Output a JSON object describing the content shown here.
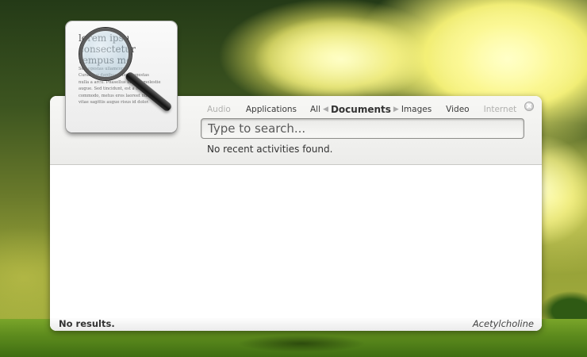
{
  "categories": {
    "audio": "Audio",
    "applications": "Applications",
    "all": "All",
    "documents": "Documents",
    "images": "Images",
    "video": "Video",
    "internet": "Internet"
  },
  "search": {
    "placeholder": "Type to search..."
  },
  "status": "No recent activities found.",
  "footer": {
    "results": "No results.",
    "theme": "Acetylcholine"
  },
  "icon": {
    "name": "documents-search-icon",
    "line1": "lorem ipsu",
    "line2": "consectetur",
    "line3": "tempus mo",
    "small_lines": [
      "amet,",
      "Nullam",
      "nisi.",
      "feugiat nisi.",
      "Sed egestas ullamcorp",
      "Curabitur dapibus. Morbi egestas",
      "nulla a arcu. Phasellus blandit molestie",
      "augue. Sed tincidunt, est a luctus",
      "commodo, metus eros laoreet nunc,",
      "vitae sagittis augue risus id dolor."
    ]
  },
  "colors": {
    "accent_text": "#333333",
    "dim_text": "#b0b0ae"
  }
}
